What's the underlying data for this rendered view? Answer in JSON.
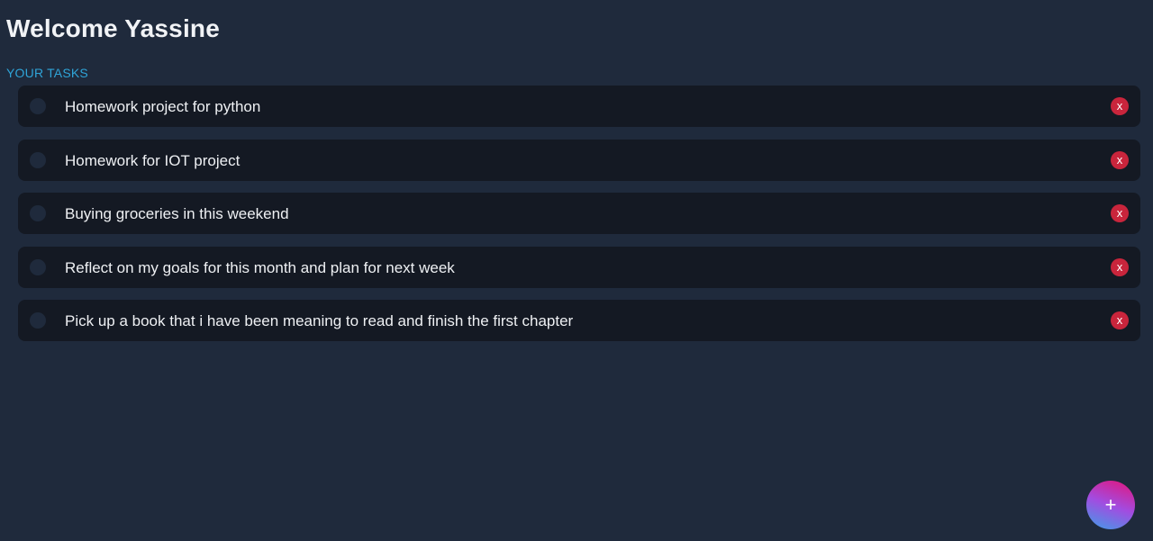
{
  "header": {
    "title": "Welcome Yassine"
  },
  "tasks_section": {
    "label": "YOUR TASKS",
    "items": [
      {
        "text": "Homework project for python",
        "delete_label": "x"
      },
      {
        "text": "Homework for IOT project",
        "delete_label": "x"
      },
      {
        "text": "Buying groceries in this weekend",
        "delete_label": "x"
      },
      {
        "text": "Reflect on my goals for this month and plan for next week",
        "delete_label": "x"
      },
      {
        "text": "Pick up a book that i have been meaning to read and finish the first chapter",
        "delete_label": "x"
      }
    ]
  },
  "add_button": {
    "label": "+"
  },
  "colors": {
    "background": "#1f2a3c",
    "task_background": "#141923",
    "accent_label": "#2fa4d8",
    "delete": "#c9253c"
  }
}
